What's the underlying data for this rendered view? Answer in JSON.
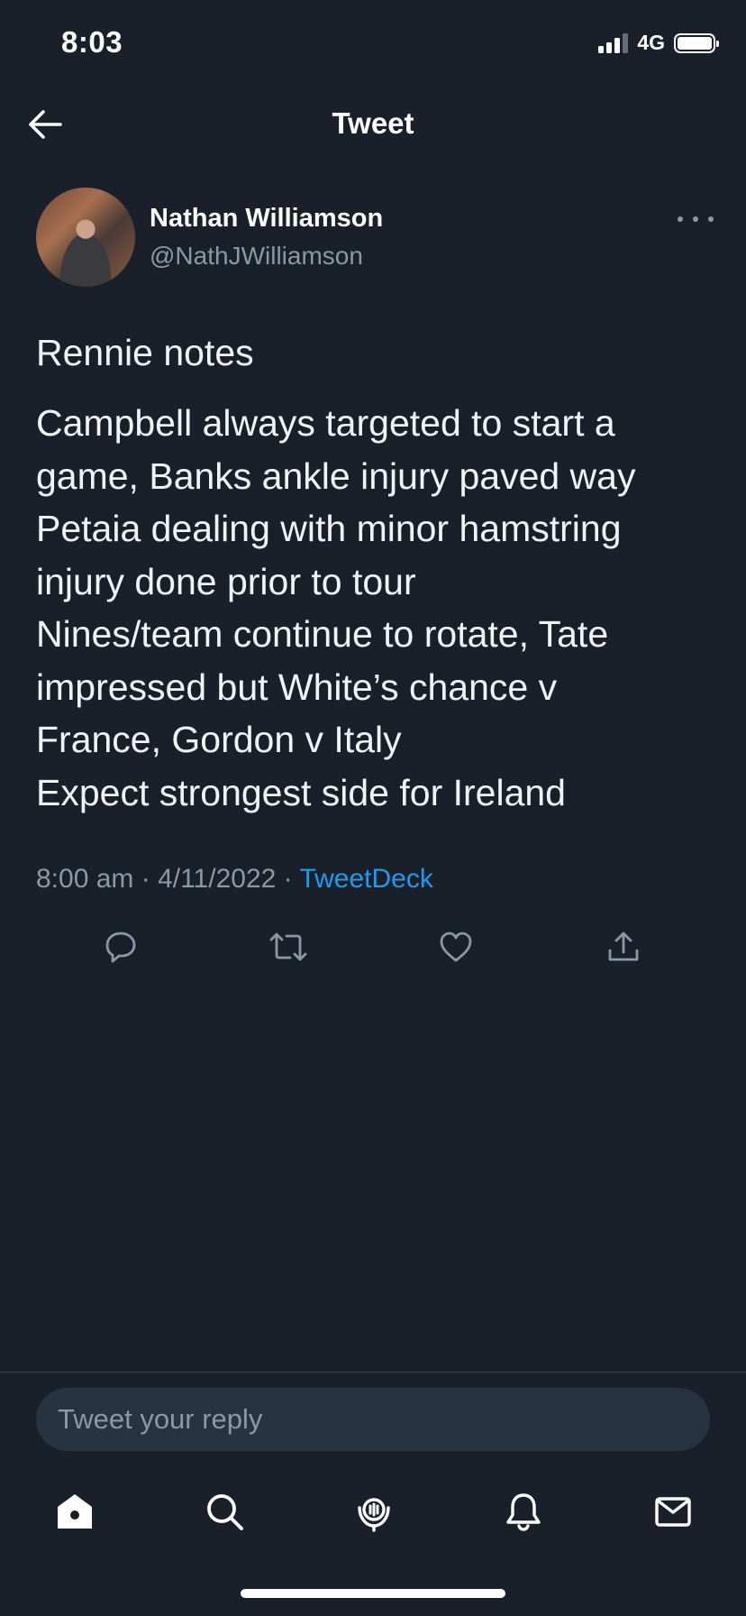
{
  "status_bar": {
    "time": "8:03",
    "network": "4G",
    "signal_bars": 3,
    "signal_bars_total": 4,
    "battery_level": 1.0
  },
  "header": {
    "title": "Tweet",
    "back_icon": "back-arrow-icon"
  },
  "author": {
    "name": "Nathan Williamson",
    "handle": "@NathJWilliamson"
  },
  "tweet": {
    "title": "Rennie notes",
    "lines": [
      "Campbell always targeted to start a",
      "game, Banks ankle injury paved way",
      "Petaia dealing with minor hamstring",
      "injury done prior to tour",
      "Nines/team continue to rotate, Tate",
      "impressed but White’s chance v",
      "France, Gordon v Italy",
      "Expect strongest side for Ireland"
    ],
    "time": "8:00 am",
    "separator": " · ",
    "date": "4/11/2022",
    "source": "TweetDeck"
  },
  "actions": [
    "reply-icon",
    "retweet-icon",
    "like-icon",
    "share-icon"
  ],
  "reply": {
    "placeholder": "Tweet your reply"
  },
  "bottom_nav": [
    "home-icon",
    "search-icon",
    "spaces-icon",
    "notifications-icon",
    "messages-icon"
  ],
  "colors": {
    "background": "#192029",
    "text": "#f1f4f6",
    "secondary": "#8b98a5",
    "accent": "#1d9bf0",
    "input_bg": "#273340"
  }
}
